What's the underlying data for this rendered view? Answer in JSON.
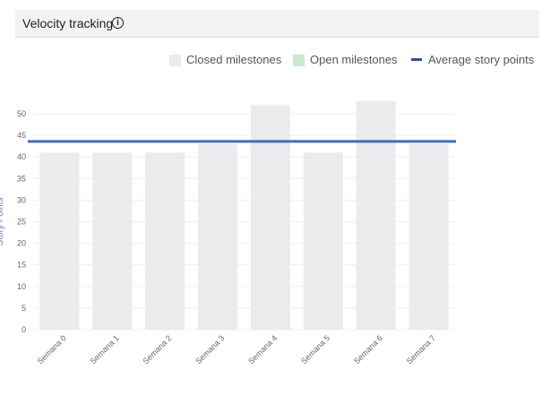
{
  "panel": {
    "title": "Velocity tracking",
    "info_glyph": "i",
    "info_icon": "info-icon"
  },
  "colors": {
    "closed": "#ebebed",
    "open": "#c9e8cf",
    "average": "#3a6fc4",
    "grid": "#eeeeee"
  },
  "legend": {
    "closed": "Closed milestones",
    "open": "Open milestones",
    "average": "Average story points"
  },
  "chart_data": {
    "type": "bar",
    "categories": [
      "Semana 0",
      "Semana 1",
      "Semana 2",
      "Semana 3",
      "Semana 4",
      "Semana 5",
      "Semana 6",
      "Semana 7"
    ],
    "series": [
      {
        "name": "Closed milestones",
        "values": [
          41,
          41,
          41,
          43,
          52,
          41,
          53,
          43
        ]
      },
      {
        "name": "Open milestones",
        "values": [
          0,
          0,
          0,
          0,
          0,
          0,
          0,
          0
        ]
      }
    ],
    "average_line": {
      "name": "Average story points",
      "value": 43.6
    },
    "ylabel": "Story Points",
    "ylim": [
      0,
      50
    ],
    "yticks": [
      0,
      5,
      10,
      15,
      20,
      25,
      30,
      35,
      40,
      45,
      50
    ],
    "grid": true,
    "legend_position": "top-right"
  }
}
